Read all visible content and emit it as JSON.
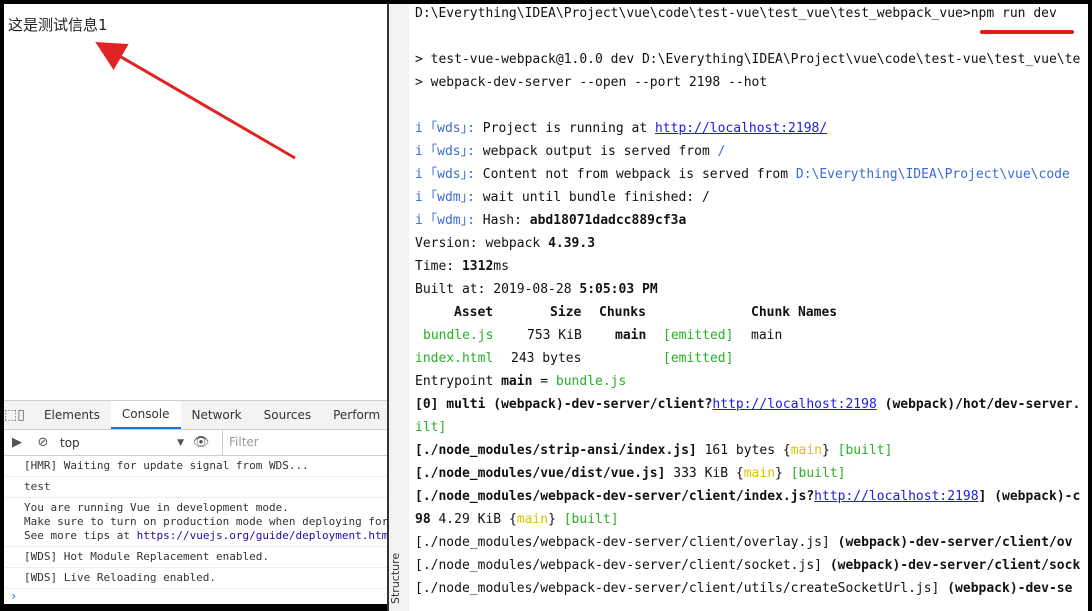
{
  "browser": {
    "page_text": "这是测试信息1"
  },
  "devtools": {
    "tabs": [
      {
        "label": "Elements"
      },
      {
        "label": "Console"
      },
      {
        "label": "Network"
      },
      {
        "label": "Sources"
      },
      {
        "label": "Perform"
      }
    ],
    "active_tab": "Console",
    "context": "top",
    "filter_placeholder": "Filter",
    "messages": {
      "hmr": "[HMR] Waiting for update signal from WDS...",
      "test": "test",
      "vue_dev_1": "You are running Vue in development mode.",
      "vue_dev_2": "Make sure to turn on production mode when deploying for",
      "vue_dev_3_prefix": "See more tips at ",
      "vue_dev_3_link": "https://vuejs.org/guide/deployment.htm",
      "wds_hmr": "[WDS] Hot Module Replacement enabled.",
      "wds_live": "[WDS] Live Reloading enabled."
    },
    "prompt_symbol": "›"
  },
  "side_strip": {
    "label": "Structure"
  },
  "terminal": {
    "l1_path": "D:\\Everything\\IDEA\\Project\\vue\\code\\test-vue\\test_vue\\test_webpack_vue>",
    "l1_cmd": "npm run dev",
    "l2": "> test-vue-webpack@1.0.0 dev D:\\Everything\\IDEA\\Project\\vue\\code\\test-vue\\test_vue\\te",
    "l3": "> webpack-dev-server --open --port 2198 --hot",
    "wds_prefix": "i ｢wds｣: ",
    "wdm_prefix": "i ｢wdm｣: ",
    "l4_text": "Project is running at ",
    "l4_link": "http://localhost:2198/",
    "l5_text": "webpack output is served from ",
    "l5_path": "/",
    "l6_text": "Content not from webpack is served from ",
    "l6_path": "D:\\Everything\\IDEA\\Project\\vue\\code",
    "l7_text": "wait until bundle finished: /",
    "l8_text": "Hash: ",
    "l8_hash": "abd18071dadcc889cf3a",
    "l9_text": "Version: webpack ",
    "l9_version": "4.39.3",
    "l10_text": "Time: ",
    "l10_time": "1312",
    "l10_unit": "ms",
    "l11_text": "Built at: 2019-08-28 ",
    "l11_time": "5:05:03 PM",
    "table_header": {
      "asset": "Asset",
      "size": "Size",
      "chunks": "Chunks",
      "chunk_names": "Chunk Names"
    },
    "rows": [
      {
        "asset": "bundle.js",
        "size": "753 KiB",
        "chunk": "main",
        "status": "[emitted]",
        "name": "main"
      },
      {
        "asset": "index.html",
        "size": "243 bytes",
        "chunk": "",
        "status": "[emitted]",
        "name": ""
      }
    ],
    "entry_text": "Entrypoint ",
    "entry_name": "main",
    "entry_eq": " = ",
    "entry_file": "bundle.js",
    "m0_a": "[0] multi (webpack)-dev-server/client?",
    "m0_link": "http://localhost:2198",
    "m0_b": " (webpack)/hot/dev-server.",
    "m0_c": "ilt]",
    "m1_file": "[./node_modules/strip-ansi/index.js]",
    "m1_size": " 161 bytes ",
    "m2_file": "[./node_modules/vue/dist/vue.js]",
    "m2_size": " 333 KiB ",
    "m3_file": "[./node_modules/webpack-dev-server/client/index.js?",
    "m3_link": "http://localhost:2198",
    "m3_end": "] ",
    "m3_b": "(webpack)-c",
    "m3_cont": "98",
    "m3_size": " 4.29 KiB ",
    "m4_file": "[./node_modules/webpack-dev-server/client/overlay.js] ",
    "m4_b": "(webpack)-dev-server/client/ov",
    "m5_file": "[./node_modules/webpack-dev-server/client/socket.js] ",
    "m5_b": "(webpack)-dev-server/client/sock",
    "m6_file": "[./node_modules/webpack-dev-server/client/utils/createSocketUrl.js] ",
    "m6_b": "(webpack)-dev-se",
    "brace_open": "{",
    "brace_close": "}",
    "chunk_main": "main",
    "built": "[built]"
  }
}
